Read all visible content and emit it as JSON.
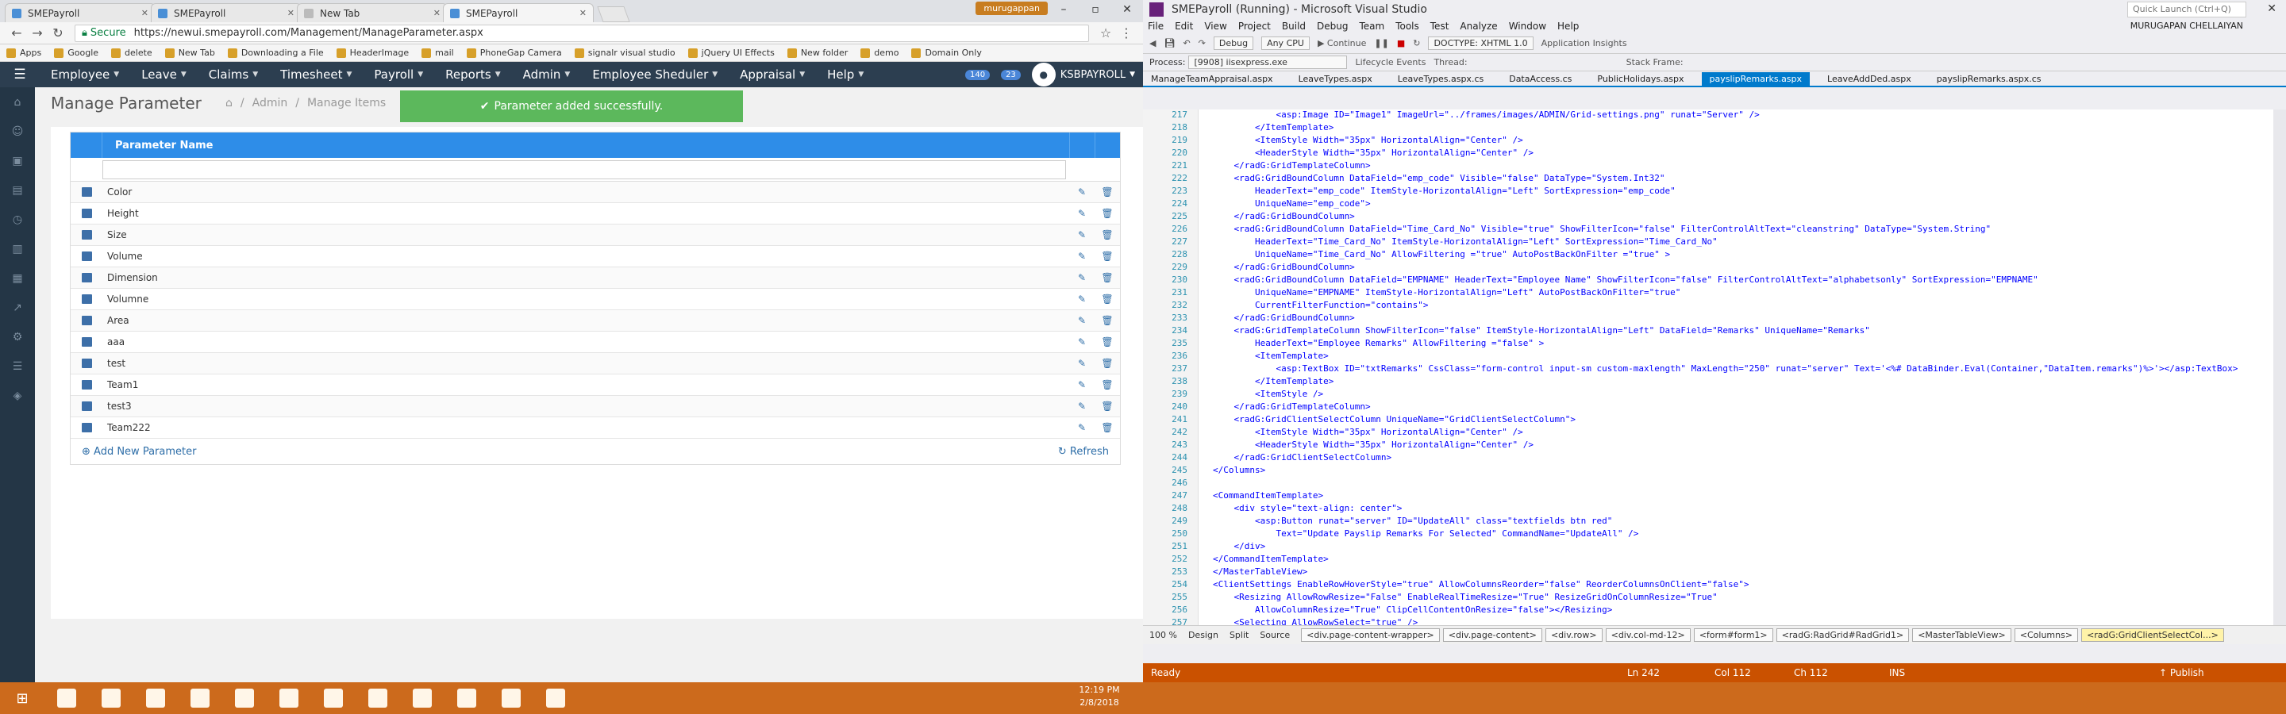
{
  "browser": {
    "tabs": [
      {
        "label": "SMEPayroll",
        "active": false
      },
      {
        "label": "SMEPayroll",
        "active": false
      },
      {
        "label": "New Tab",
        "active": false
      },
      {
        "label": "SMEPayroll",
        "active": true
      }
    ],
    "user_chip": "murugappan",
    "secure_label": "Secure",
    "url": "https://newui.smepayroll.com/Management/ManageParameter.aspx",
    "bookmarks": [
      "Apps",
      "Google",
      "delete",
      "New Tab",
      "Downloading a File",
      "HeaderImage",
      "mail",
      "PhoneGap Camera",
      "signalr visual studio",
      "jQuery UI Effects",
      "New folder",
      "demo",
      "Domain Only"
    ]
  },
  "app": {
    "menu": [
      {
        "label": "Employee"
      },
      {
        "label": "Leave"
      },
      {
        "label": "Claims"
      },
      {
        "label": "Timesheet"
      },
      {
        "label": "Payroll"
      },
      {
        "label": "Reports"
      },
      {
        "label": "Admin"
      },
      {
        "label": "Employee Sheduler"
      },
      {
        "label": "Appraisal"
      },
      {
        "label": "Help"
      }
    ],
    "badge1": "140",
    "badge2": "23",
    "username": "KSBPAYROLL",
    "page_title": "Manage Parameter",
    "breadcrumb": [
      "Admin",
      "Manage Items"
    ],
    "toast": "Parameter added successfully.",
    "grid": {
      "header": "Parameter Name",
      "rows": [
        "Color",
        "Height",
        "Size",
        "Volume",
        "Dimension",
        "Volumne",
        "Area",
        "aaa",
        "test",
        "Team1",
        "test3",
        "Team222"
      ],
      "add_label": "Add New Parameter",
      "refresh_label": "Refresh"
    }
  },
  "vs": {
    "title": "SMEPayroll (Running) - Microsoft Visual Studio",
    "quick_launch": "Quick Launch (Ctrl+Q)",
    "user": "MURUGAPAN CHELLAIYAN",
    "menu": [
      "File",
      "Edit",
      "View",
      "Project",
      "Build",
      "Debug",
      "Team",
      "Tools",
      "Test",
      "Analyze",
      "Window",
      "Help"
    ],
    "toolbar": {
      "debug": "Debug",
      "cpu": "Any CPU",
      "continue": "Continue",
      "doctype": "DOCTYPE: XHTML 1.0",
      "insights": "Application Insights"
    },
    "process": "Process:",
    "process_value": "[9908] iisexpress.exe",
    "lifecycle": "Lifecycle Events",
    "thread": "Thread:",
    "stack": "Stack Frame:",
    "doc_tabs": [
      "ManageTeamAppraisal.aspx",
      "LeaveTypes.aspx",
      "LeaveTypes.aspx.cs",
      "DataAccess.cs",
      "PublicHolidays.aspx",
      "payslipRemarks.aspx",
      "LeaveAddDed.aspx",
      "payslipRemarks.aspx.cs"
    ],
    "active_doc": 5,
    "code": [
      {
        "n": "217",
        "t": "            <asp:Image ID=\"Image1\" ImageUrl=\"../frames/images/ADMIN/Grid-settings.png\" runat=\"Server\" />"
      },
      {
        "n": "218",
        "t": "        </ItemTemplate>"
      },
      {
        "n": "219",
        "t": "        <ItemStyle Width=\"35px\" HorizontalAlign=\"Center\" />"
      },
      {
        "n": "220",
        "t": "        <HeaderStyle Width=\"35px\" HorizontalAlign=\"Center\" />"
      },
      {
        "n": "221",
        "t": "    </radG:GridTemplateColumn>"
      },
      {
        "n": "222",
        "t": "    <radG:GridBoundColumn DataField=\"emp_code\" Visible=\"false\" DataType=\"System.Int32\""
      },
      {
        "n": "223",
        "t": "        HeaderText=\"emp_code\" ItemStyle-HorizontalAlign=\"Left\" SortExpression=\"emp_code\""
      },
      {
        "n": "224",
        "t": "        UniqueName=\"emp_code\">"
      },
      {
        "n": "225",
        "t": "    </radG:GridBoundColumn>"
      },
      {
        "n": "226",
        "t": "    <radG:GridBoundColumn DataField=\"Time_Card_No\" Visible=\"true\" ShowFilterIcon=\"false\" FilterControlAltText=\"cleanstring\" DataType=\"System.String\""
      },
      {
        "n": "227",
        "t": "        HeaderText=\"Time_Card_No\" ItemStyle-HorizontalAlign=\"Left\" SortExpression=\"Time_Card_No\""
      },
      {
        "n": "228",
        "t": "        UniqueName=\"Time_Card_No\" AllowFiltering =\"true\" AutoPostBackOnFilter =\"true\" >"
      },
      {
        "n": "229",
        "t": "    </radG:GridBoundColumn>"
      },
      {
        "n": "230",
        "t": "    <radG:GridBoundColumn DataField=\"EMPNAME\" HeaderText=\"Employee Name\" ShowFilterIcon=\"false\" FilterControlAltText=\"alphabetsonly\" SortExpression=\"EMPNAME\""
      },
      {
        "n": "231",
        "t": "        UniqueName=\"EMPNAME\" ItemStyle-HorizontalAlign=\"Left\" AutoPostBackOnFilter=\"true\""
      },
      {
        "n": "232",
        "t": "        CurrentFilterFunction=\"contains\">"
      },
      {
        "n": "233",
        "t": "    </radG:GridBoundColumn>"
      },
      {
        "n": "234",
        "t": "    <radG:GridTemplateColumn ShowFilterIcon=\"false\" ItemStyle-HorizontalAlign=\"Left\" DataField=\"Remarks\" UniqueName=\"Remarks\""
      },
      {
        "n": "235",
        "t": "        HeaderText=\"Employee Remarks\" AllowFiltering =\"false\" >"
      },
      {
        "n": "236",
        "t": "        <ItemTemplate>"
      },
      {
        "n": "237",
        "t": "            <asp:TextBox ID=\"txtRemarks\" CssClass=\"form-control input-sm custom-maxlength\" MaxLength=\"250\" runat=\"server\" Text='<%# DataBinder.Eval(Container,\"DataItem.remarks\")%>'></asp:TextBox>"
      },
      {
        "n": "238",
        "t": "        </ItemTemplate>"
      },
      {
        "n": "239",
        "t": "        <ItemStyle />"
      },
      {
        "n": "240",
        "t": "    </radG:GridTemplateColumn>"
      },
      {
        "n": "241",
        "t": "    <radG:GridClientSelectColumn UniqueName=\"GridClientSelectColumn\">"
      },
      {
        "n": "242",
        "t": "        <ItemStyle Width=\"35px\" HorizontalAlign=\"Center\" />"
      },
      {
        "n": "243",
        "t": "        <HeaderStyle Width=\"35px\" HorizontalAlign=\"Center\" />"
      },
      {
        "n": "244",
        "t": "    </radG:GridClientSelectColumn>"
      },
      {
        "n": "245",
        "t": "</Columns>"
      },
      {
        "n": "246",
        "t": ""
      },
      {
        "n": "247",
        "t": "<CommandItemTemplate>"
      },
      {
        "n": "248",
        "t": "    <div style=\"text-align: center\">"
      },
      {
        "n": "249",
        "t": "        <asp:Button runat=\"server\" ID=\"UpdateAll\" class=\"textfields btn red\""
      },
      {
        "n": "250",
        "t": "            Text=\"Update Payslip Remarks For Selected\" CommandName=\"UpdateAll\" />"
      },
      {
        "n": "251",
        "t": "    </div>"
      },
      {
        "n": "252",
        "t": "</CommandItemTemplate>"
      },
      {
        "n": "253",
        "t": "</MasterTableView>"
      },
      {
        "n": "254",
        "t": "<ClientSettings EnableRowHoverStyle=\"true\" AllowColumnsReorder=\"false\" ReorderColumnsOnClient=\"false\">"
      },
      {
        "n": "255",
        "t": "    <Resizing AllowRowResize=\"False\" EnableRealTimeResize=\"True\" ResizeGridOnColumnResize=\"True\""
      },
      {
        "n": "256",
        "t": "        AllowColumnResize=\"True\" ClipCellContentOnResize=\"false\"></Resizing>"
      },
      {
        "n": "257",
        "t": "    <Selecting AllowRowSelect=\"true\" />"
      }
    ],
    "zoom": "100 %",
    "views": [
      "Design",
      "Split",
      "Source"
    ],
    "element_path": [
      "<div.page-content-wrapper>",
      "<div.page-content>",
      "<div.row>",
      "<div.col-md-12>",
      "<form#form1>",
      "<radG:RadGrid#RadGrid1>",
      "<MasterTableView>",
      "<Columns>",
      "<radG:GridClientSelectCol...>"
    ],
    "status": {
      "left": "Ready",
      "ln": "Ln 242",
      "col": "Col 112",
      "ch": "Ch 112",
      "ins": "INS",
      "publish": "Publish"
    }
  },
  "taskbar": {
    "time": "12:19 PM",
    "date": "2/8/2018"
  },
  "colors": {
    "accent_blue": "#2e8de8",
    "toast_green": "#5cb85c",
    "nav_dark": "#2c3e50",
    "vs_status": "#ca5100",
    "taskbar": "#cc6a1c"
  }
}
